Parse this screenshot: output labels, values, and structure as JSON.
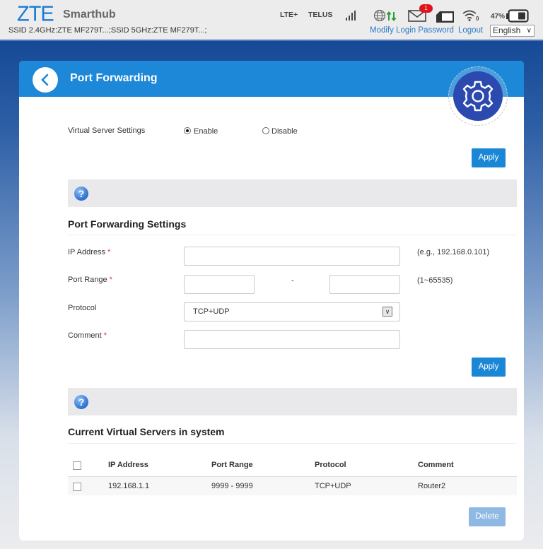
{
  "header": {
    "logo": "ZTE",
    "brand": "Smarthub",
    "ssid": "SSID 2.4GHz:ZTE MF279T...;SSID 5GHz:ZTE MF279T...;",
    "network_type": "LTE+",
    "carrier": "TELUS",
    "unread_messages": "1",
    "wifi_clients": "0",
    "battery": "47%",
    "modify_password": "Modify Login Password",
    "logout": "Logout",
    "language": "English"
  },
  "page": {
    "title": "Port Forwarding"
  },
  "virtual_server": {
    "label": "Virtual Server Settings",
    "options": [
      {
        "label": "Enable",
        "selected": true
      },
      {
        "label": "Disable",
        "selected": false
      }
    ],
    "apply": "Apply"
  },
  "settings": {
    "title": "Port Forwarding Settings",
    "ip_label": "IP Address",
    "ip_value": "",
    "ip_hint": "(e.g., 192.168.0.101)",
    "port_label": "Port Range",
    "port_start": "",
    "port_end": "",
    "port_sep": "-",
    "port_hint": "(1~65535)",
    "protocol_label": "Protocol",
    "protocol_value": "TCP+UDP",
    "comment_label": "Comment",
    "comment_value": "",
    "required_mark": "*",
    "apply": "Apply"
  },
  "servers": {
    "title": "Current Virtual Servers in system",
    "columns": [
      "IP Address",
      "Port Range",
      "Protocol",
      "Comment"
    ],
    "rows": [
      {
        "ip": "192.168.1.1",
        "ports": "9999 - 9999",
        "protocol": "TCP+UDP",
        "comment": "Router2",
        "checked": false
      }
    ],
    "delete": "Delete"
  },
  "help_icon": "?",
  "colors": {
    "accent": "#1a86d6",
    "header_blue": "#1d87d8",
    "gear_bg": "#2b49ae",
    "unread_badge": "#e0141c",
    "link": "#2d7ac9"
  }
}
